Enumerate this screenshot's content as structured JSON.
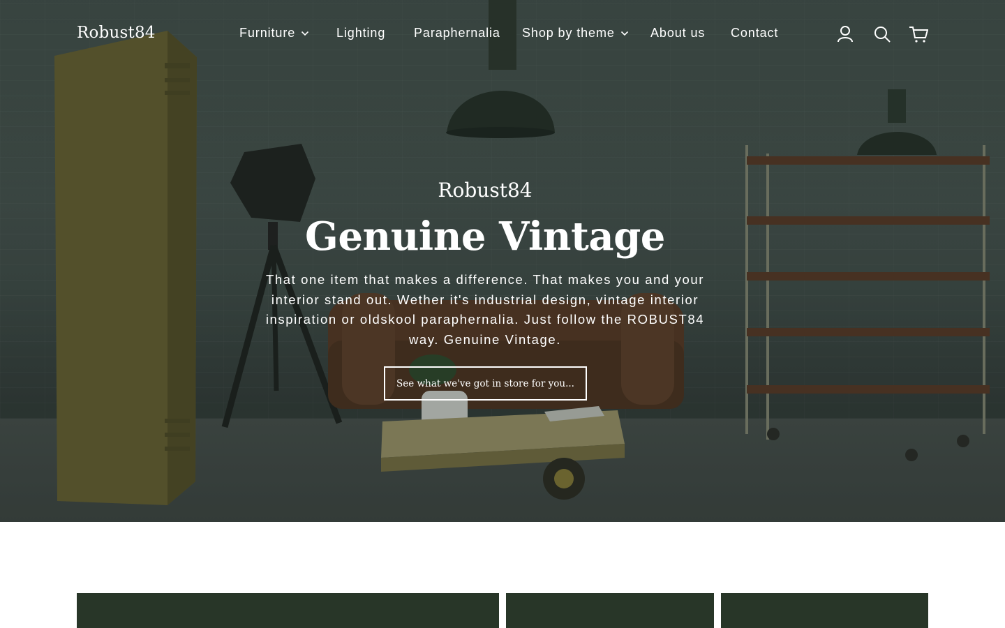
{
  "header": {
    "logo": "Robust84",
    "nav": [
      {
        "label": "Furniture",
        "has_dropdown": true
      },
      {
        "label": "Lighting",
        "has_dropdown": false
      },
      {
        "label": "Paraphernalia",
        "has_dropdown": false
      },
      {
        "label": "Shop by theme",
        "has_dropdown": true
      },
      {
        "label": "About us",
        "has_dropdown": false
      },
      {
        "label": "Contact",
        "has_dropdown": false
      }
    ],
    "icons": [
      "account-icon",
      "search-icon",
      "cart-icon"
    ]
  },
  "hero": {
    "subheading": "Robust84",
    "title": "Genuine Vintage",
    "text": "That one item that makes a difference. That makes you and your interior stand out. Wether it's industrial design, vintage interior inspiration or oldskool paraphernalia. Just follow the ROBUST84 way. Genuine Vintage.",
    "button_label": "See what we've got in store for you..."
  },
  "colors": {
    "tile": "#283628",
    "text": "#ffffff"
  }
}
